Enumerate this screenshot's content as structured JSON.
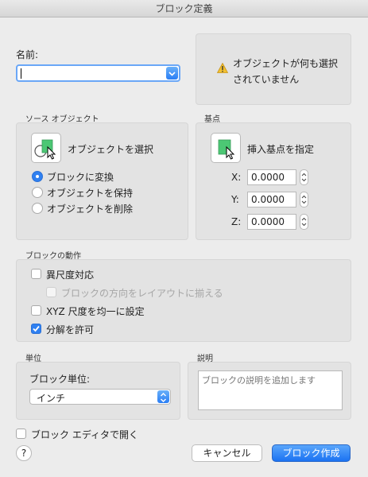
{
  "window": {
    "title": "ブロック定義"
  },
  "name": {
    "label": "名前:",
    "value": ""
  },
  "warning": {
    "line1": "オブジェクトが何も選択",
    "line2": "されていません"
  },
  "source": {
    "heading": "ソース オブジェクト",
    "select_label": "オブジェクトを選択",
    "options": [
      "ブロックに変換",
      "オブジェクトを保持",
      "オブジェクトを削除"
    ],
    "selected_index": 0
  },
  "base": {
    "heading": "基点",
    "pick_label": "挿入基点を指定",
    "x_label": "X:",
    "x_value": "0.0000",
    "y_label": "Y:",
    "y_value": "0.0000",
    "z_label": "Z:",
    "z_value": "0.0000"
  },
  "behavior": {
    "heading": "ブロックの動作",
    "annotative": "異尺度対応",
    "match_orientation": "ブロックの方向をレイアウトに揃える",
    "uniform_scale": "XYZ 尺度を均一に設定",
    "allow_explode": "分解を許可",
    "states": {
      "annotative": false,
      "match_orientation": false,
      "uniform_scale": false,
      "allow_explode": true
    }
  },
  "units": {
    "heading": "単位",
    "label": "ブロック単位:",
    "value": "インチ"
  },
  "description": {
    "heading": "説明",
    "placeholder": "ブロックの説明を追加します"
  },
  "footer": {
    "open_editor": "ブロック エディタで開く",
    "help": "?",
    "cancel": "キャンセル",
    "create": "ブロック作成"
  },
  "colors": {
    "accent": "#2f80f1",
    "warning": "#f2c030",
    "pick_green": "#4cc774"
  }
}
